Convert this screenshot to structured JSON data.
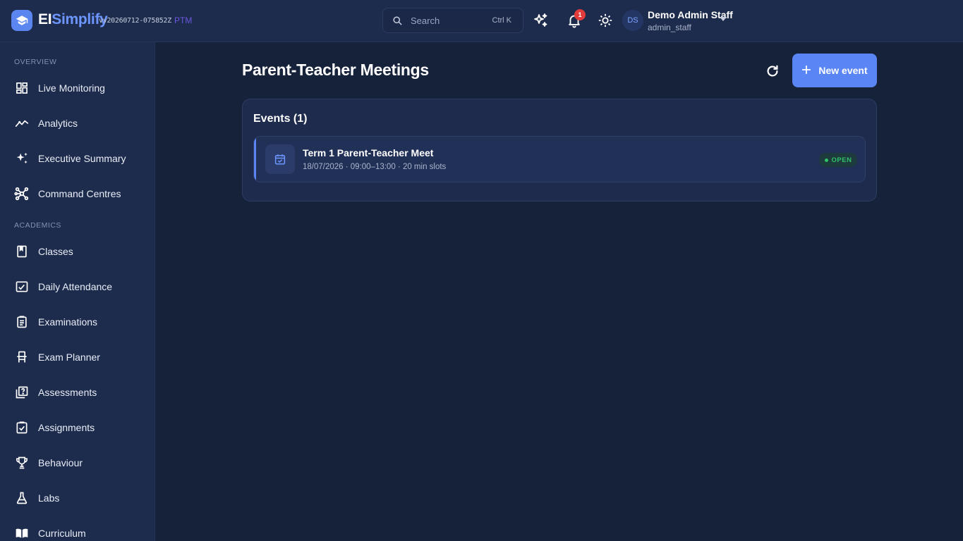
{
  "header": {
    "brand_part1": "EI",
    "brand_part2": "Simplify",
    "version": "vv20260712-075852Z",
    "module_tag": "PTM",
    "search_placeholder": "Search",
    "search_shortcut": "Ctrl K",
    "notification_count": "1",
    "user_initials": "DS",
    "user_name": "Demo Admin Staff",
    "user_handle": "admin_staff"
  },
  "sidebar": {
    "sections": [
      {
        "label": "OVERVIEW",
        "items": [
          {
            "label": "Live Monitoring",
            "icon": "dashboard-icon"
          },
          {
            "label": "Analytics",
            "icon": "trend-icon"
          },
          {
            "label": "Executive Summary",
            "icon": "sparkle-icon"
          },
          {
            "label": "Command Centres",
            "icon": "network-icon"
          }
        ]
      },
      {
        "label": "ACADEMICS",
        "items": [
          {
            "label": "Classes",
            "icon": "book-icon"
          },
          {
            "label": "Daily Attendance",
            "icon": "checklist-icon"
          },
          {
            "label": "Examinations",
            "icon": "clipboard-icon"
          },
          {
            "label": "Exam Planner",
            "icon": "chair-icon"
          },
          {
            "label": "Assessments",
            "icon": "quiz-icon"
          },
          {
            "label": "Assignments",
            "icon": "assignment-check-icon"
          },
          {
            "label": "Behaviour",
            "icon": "trophy-icon"
          },
          {
            "label": "Labs",
            "icon": "flask-icon"
          },
          {
            "label": "Curriculum",
            "icon": "open-book-icon"
          }
        ]
      }
    ]
  },
  "main": {
    "title": "Parent-Teacher Meetings",
    "new_button_label": "New event",
    "card_title": "Events (1)",
    "events": [
      {
        "name": "Term 1 Parent-Teacher Meet",
        "meta": "18/07/2026 · 09:00–13:00 · 20 min slots",
        "status": "OPEN"
      }
    ]
  },
  "colors": {
    "accent": "#5a86f5",
    "background": "#16213a",
    "panel": "#1d2b4c",
    "status_open": "#31c26a",
    "notification": "#e23b3b"
  }
}
